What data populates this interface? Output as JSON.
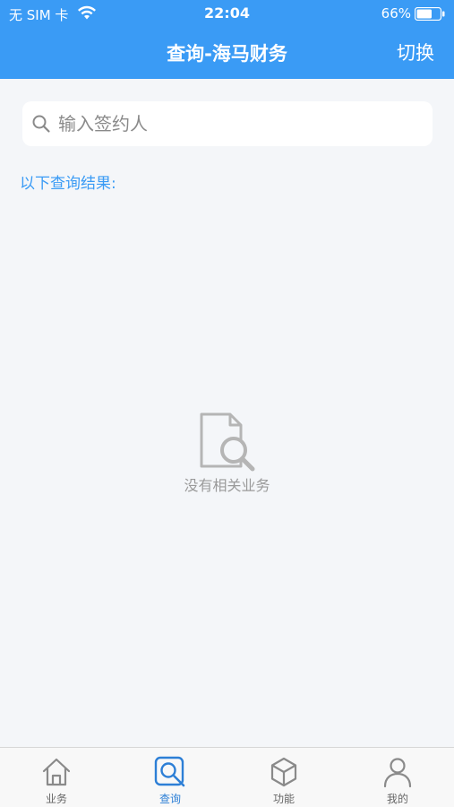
{
  "status_bar": {
    "carrier": "无 SIM 卡",
    "time": "22:04",
    "battery_percent": "66%",
    "battery_level": 0.66
  },
  "nav": {
    "title": "查询-海马财务",
    "right_action": "切换"
  },
  "search": {
    "placeholder": "输入签约人",
    "value": ""
  },
  "results": {
    "label": "以下查询结果:",
    "empty_text": "没有相关业务"
  },
  "tabbar": {
    "active_color": "#2d7fd6",
    "items": [
      {
        "label": "业务",
        "icon": "home-icon",
        "active": false
      },
      {
        "label": "查询",
        "icon": "search-doc-icon",
        "active": true
      },
      {
        "label": "功能",
        "icon": "cube-icon",
        "active": false
      },
      {
        "label": "我的",
        "icon": "user-icon",
        "active": false
      }
    ]
  },
  "colors": {
    "header": "#3a9bf5",
    "background": "#f4f6f9",
    "accent_text": "#3a9bf5"
  }
}
